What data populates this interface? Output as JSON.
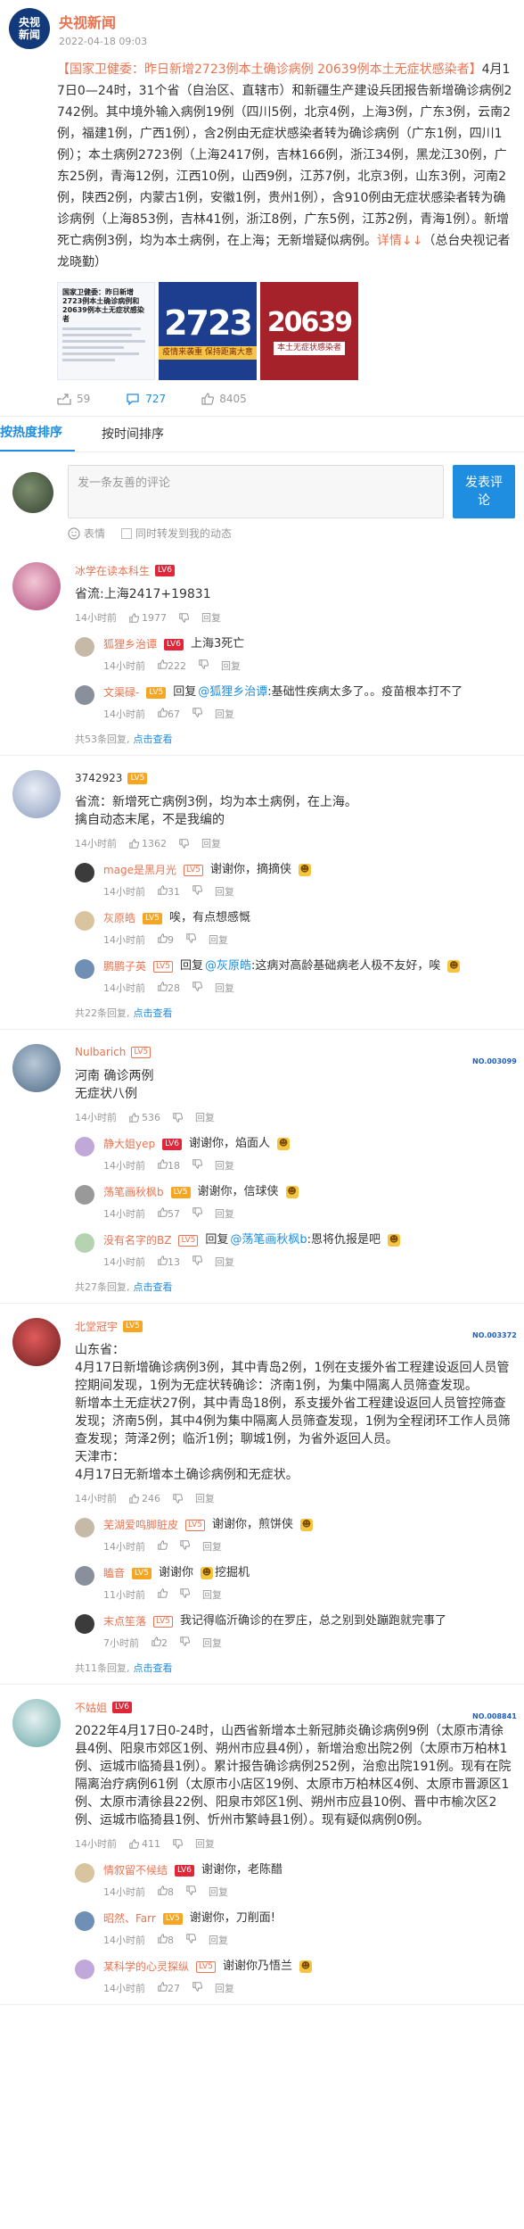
{
  "post": {
    "author": "央视新闻",
    "logo_line1": "央视",
    "logo_line2": "新闻",
    "time": "2022-04-18 09:03",
    "text_hashtag": "【国家卫健委：昨日新增2723例本土确诊病例 20639例本土无症状感染者】",
    "text_body": "4月17日0—24时，31个省（自治区、直辖市）和新疆生产建设兵团报告新增确诊病例2742例。其中境外输入病例19例（四川5例，北京4例，上海3例，广东3例，云南2例，福建1例，广西1例），含2例由无症状感染者转为确诊病例（广东1例，四川1例）；本土病例2723例（上海2417例，吉林166例，浙江34例，黑龙江30例，广东25例，青海12例，江西10例，山西9例，江苏7例，北京3例，山东3例，河南2例，陕西2例，内蒙古1例，安徽1例，贵州1例），含910例由无症状感染者转为确诊病例（上海853例，吉林41例，浙江8例，广东5例，江苏2例，青海1例）。新增死亡病例3例，均为本土病例，在上海；无新增疑似病例。",
    "detail_link": "详情↓↓",
    "source": "（总台央视记者 龙晓勤）",
    "images": {
      "doc_title": "国家卫健委：昨日新增2723例本土确诊病例和20639例本土无症状感染者",
      "num1": "2723",
      "num1_tag": "疫情来袭重 保持距离大意",
      "num2": "20639",
      "num2_tag": "本土无症状感染者"
    },
    "reposts": "59",
    "comments": "727",
    "likes": "8405"
  },
  "tabs": {
    "hot": "按热度排序",
    "time": "按时间排序"
  },
  "composer": {
    "placeholder": "发一条友善的评论",
    "emoji_label": "表情",
    "repost_label": "同时转发到我的动态",
    "send_label": "发表评论"
  },
  "comments": [
    {
      "user": "冰学在读本科生",
      "level": "LV6",
      "text": "省流:上海2417+19831",
      "time": "14小时前",
      "likes": "1977",
      "reply_label": "回复",
      "replies": [
        {
          "user": "狐狸乡治谭",
          "level": "LV6",
          "text": "上海3死亡",
          "time": "14小时前",
          "likes": "222",
          "reply_label": "回复"
        },
        {
          "user": "文渠碌-",
          "level": "LV5",
          "prefix": "回复",
          "at": "@狐狸乡治谭",
          "text": ":基础性疾病太多了。。疫苗根本打不了",
          "time": "14小时前",
          "likes": "67",
          "reply_label": "回复"
        }
      ],
      "more_text": "共53条回复,",
      "more_click": "点击查看"
    },
    {
      "user": "3742923",
      "level": "LV5",
      "text": "省流：新增死亡病例3例，均为本土病例，在上海。\n擒自动态末尾，不是我编的",
      "time": "14小时前",
      "likes": "1362",
      "reply_label": "回复",
      "replies": [
        {
          "user": "mage是黑月光",
          "level": "LV5",
          "text": "谢谢你，摘摘侠",
          "time": "14小时前",
          "likes": "31",
          "reply_label": "回复"
        },
        {
          "user": "灰原皓",
          "level": "LV5",
          "text": "唉，有点想感慨",
          "time": "14小时前",
          "likes": "9",
          "reply_label": "回复"
        },
        {
          "user": "鹏鹏子英",
          "level": "LV5",
          "prefix": "回复",
          "at": "@灰原皓",
          "text": ":这病对高龄基础病老人极不友好，唉",
          "time": "14小时前",
          "likes": "28",
          "reply_label": "回复"
        }
      ],
      "more_text": "共22条回复,",
      "more_click": "点击查看"
    },
    {
      "user": "Nulbarich",
      "level": "LV5",
      "badge": "NO.003099",
      "text": "河南  确诊两例\n         无症状八例",
      "time": "14小时前",
      "likes": "536",
      "reply_label": "回复",
      "replies": [
        {
          "user": "静大姐yep",
          "level": "LV6",
          "text": "谢谢你，焰面人",
          "time": "14小时前",
          "likes": "18",
          "reply_label": "回复"
        },
        {
          "user": "荡笔画秋枫b",
          "level": "LV5",
          "text": "谢谢你，信球侠",
          "time": "14小时前",
          "likes": "57",
          "reply_label": "回复"
        },
        {
          "user": "没有名字的BZ",
          "level": "LV5",
          "prefix": "回复",
          "at": "@荡笔画秋枫b",
          "text": ":恩将仇报是吧",
          "time": "14小时前",
          "likes": "13",
          "reply_label": "回复"
        }
      ],
      "more_text": "共27条回复,",
      "more_click": "点击查看"
    },
    {
      "user": "北堂冠宇",
      "level": "LV5",
      "badge": "NO.003372",
      "text": "山东省：\n4月17日新增确诊病例3例，其中青岛2例，1例在支援外省工程建设返回人员管控期间发现，1例为无症状转确诊：济南1例，为集中隔离人员筛查发现。\n新增本土无症状27例，其中青岛18例，系支援外省工程建设返回人员管控筛查发现；济南5例，其中4例为集中隔离人员筛查发现，1例为全程闭环工作人员筛查发现；菏泽2例；临沂1例；聊城1例，为省外返回人员。\n天津市：\n4月17日无新增本土确诊病例和无症状。",
      "time": "14小时前",
      "likes": "246",
      "reply_label": "回复",
      "replies": [
        {
          "user": "芜湖爱鸣脚脏皮",
          "level": "LV5",
          "text": "谢谢你，煎饼侠",
          "time": "14小时前",
          "likes": "",
          "reply_label": "回复"
        },
        {
          "user": "瞌音",
          "level": "LV5",
          "text": "谢谢你",
          "text_after": "挖掘机",
          "time": "11小时前",
          "likes": "",
          "reply_label": "回复"
        },
        {
          "user": "末点笙落",
          "level": "LV5",
          "text": "我记得临沂确诊的在罗庄，总之别到处蹦跑就完事了",
          "time": "7小时前",
          "likes": "2",
          "reply_label": "回复"
        }
      ],
      "more_text": "共11条回复,",
      "more_click": "点击查看"
    },
    {
      "user": "不姑姐",
      "level": "LV6",
      "badge": "NO.008841",
      "text": "2022年4月17日0-24时，山西省新增本土新冠肺炎确诊病例9例（太原市清徐县4例、阳泉市郊区1例、朔州市应县4例），新增治愈出院2例（太原市万柏林1例、运城市临猗县1例）。累计报告确诊病例252例，治愈出院191例。现有在院隔离治疗病例61例（太原市小店区19例、太原市万柏林区4例、太原市晋源区1例、太原市清徐县22例、阳泉市郊区1例、朔州市应县10例、晋中市榆次区2例、运城市临猗县1例、忻州市繁峙县1例）。现有疑似病例0例。",
      "time": "14小时前",
      "likes": "411",
      "reply_label": "回复",
      "replies": [
        {
          "user": "情叙留不候结",
          "level": "LV6",
          "text": "谢谢你，老陈醋",
          "time": "14小时前",
          "likes": "8",
          "reply_label": "回复"
        },
        {
          "user": "昭然、Farr",
          "level": "LV5",
          "text": "谢谢你，刀削面!",
          "time": "14小时前",
          "likes": "8",
          "reply_label": "回复"
        },
        {
          "user": "某科学的心灵探纵",
          "level": "LV5",
          "text": "谢谢你乃悟兰",
          "time": "14小时前",
          "likes": "27",
          "reply_label": "回复"
        }
      ],
      "more_text": "",
      "more_click": ""
    }
  ],
  "colors": {
    "accent": "#1f8de0",
    "username": "#eb7350",
    "muted": "#999999"
  }
}
